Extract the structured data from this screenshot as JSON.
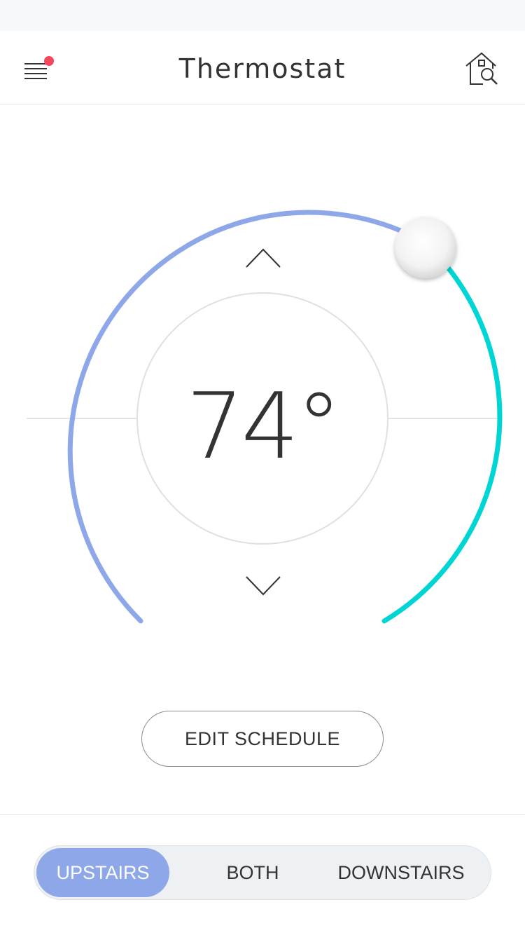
{
  "header": {
    "title": "Thermostat",
    "menu_icon": "hamburger-menu-icon",
    "notification_color": "#f4475b",
    "home_search_icon": "home-search-icon"
  },
  "thermostat": {
    "temperature": "74°",
    "setpoint_value": 74,
    "up_icon": "chevron-up-icon",
    "down_icon": "chevron-down-icon",
    "arc_color_primary": "#8ea7e9",
    "arc_color_secondary": "#00d5d6"
  },
  "actions": {
    "edit_schedule_label": "EDIT SCHEDULE"
  },
  "zone_selector": {
    "options": [
      {
        "label": "UPSTAIRS",
        "active": true
      },
      {
        "label": "BOTH",
        "active": false
      },
      {
        "label": "DOWNSTAIRS",
        "active": false
      }
    ],
    "active_color": "#8ea7e9"
  }
}
